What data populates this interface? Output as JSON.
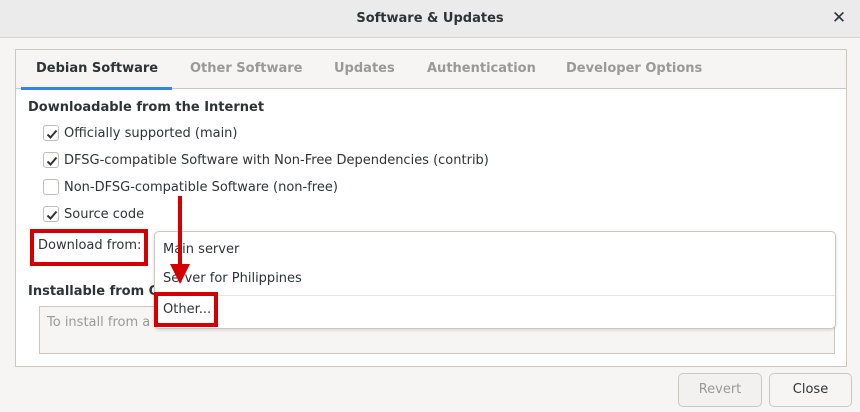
{
  "window": {
    "title": "Software & Updates",
    "close_glyph": "✕"
  },
  "tabs": [
    {
      "label": "Debian Software",
      "active": true
    },
    {
      "label": "Other Software",
      "active": false
    },
    {
      "label": "Updates",
      "active": false
    },
    {
      "label": "Authentication",
      "active": false
    },
    {
      "label": "Developer Options",
      "active": false
    }
  ],
  "downloadable": {
    "title": "Downloadable from the Internet",
    "options": [
      {
        "label": "Officially supported (main)",
        "checked": true
      },
      {
        "label": "DFSG-compatible Software with Non-Free Dependencies (contrib)",
        "checked": true
      },
      {
        "label": "Non-DFSG-compatible Software (non-free)",
        "checked": false
      },
      {
        "label": "Source code",
        "checked": true
      }
    ],
    "download_from_label": "Download from:",
    "server_menu": {
      "items": [
        "Main server",
        "Server for Philippines",
        "Other..."
      ]
    }
  },
  "installable": {
    "title": "Installable from C",
    "placeholder": "To install from a"
  },
  "buttons": {
    "revert": "Revert",
    "close": "Close"
  },
  "colors": {
    "accent": "#3584e4",
    "highlight": "#d40000"
  }
}
